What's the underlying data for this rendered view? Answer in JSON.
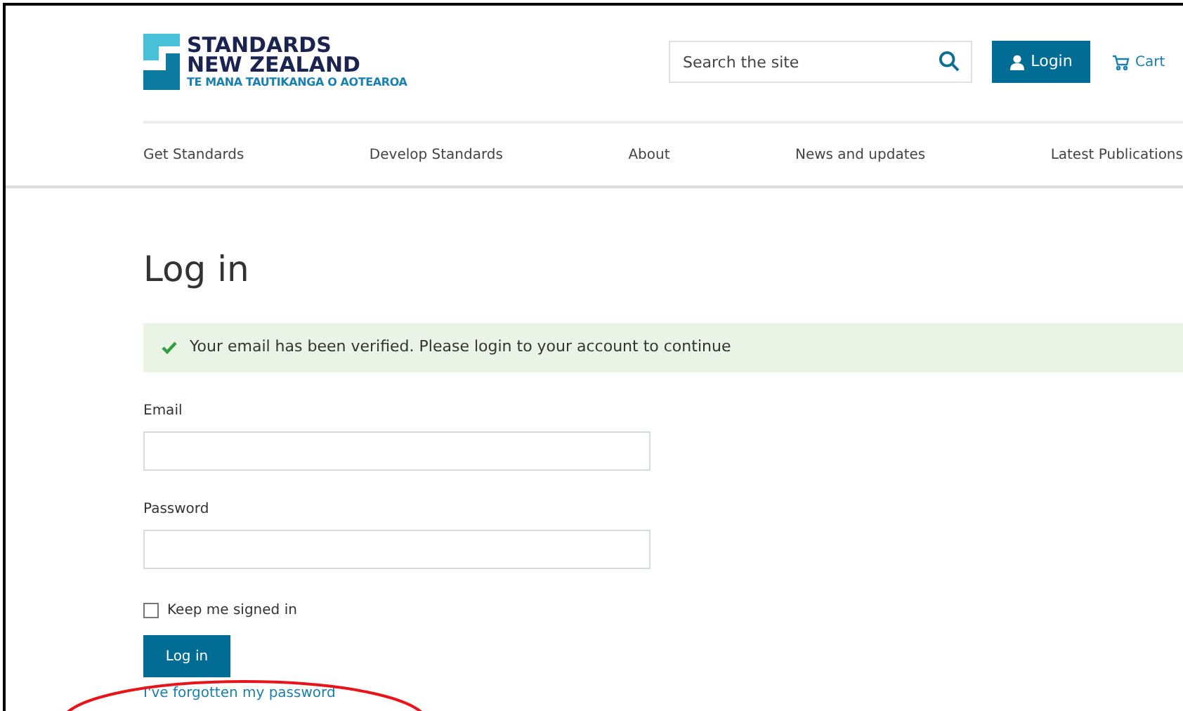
{
  "logo": {
    "line_1": "STANDARDS",
    "line_2": "NEW ZEALAND",
    "tagline": "TE MANA TAUTIKANGA O AOTEAROA"
  },
  "search": {
    "placeholder": "Search the site"
  },
  "login_button": "Login",
  "cart": "Cart",
  "nav": [
    {
      "label": "Get Standards"
    },
    {
      "label": "Develop Standards"
    },
    {
      "label": "About"
    },
    {
      "label": "News and updates"
    },
    {
      "label": "Latest Publications"
    }
  ],
  "heading": "Log in",
  "alert": {
    "kind": "success",
    "text": "Your email has been verified. Please login to your account to continue"
  },
  "fields": [
    {
      "label": "Email"
    },
    {
      "label": "Password"
    }
  ],
  "remember": {
    "label": "Keep me signed in",
    "checked": false
  },
  "submit": "Log in",
  "forgot_link": "I've forgotten my password"
}
